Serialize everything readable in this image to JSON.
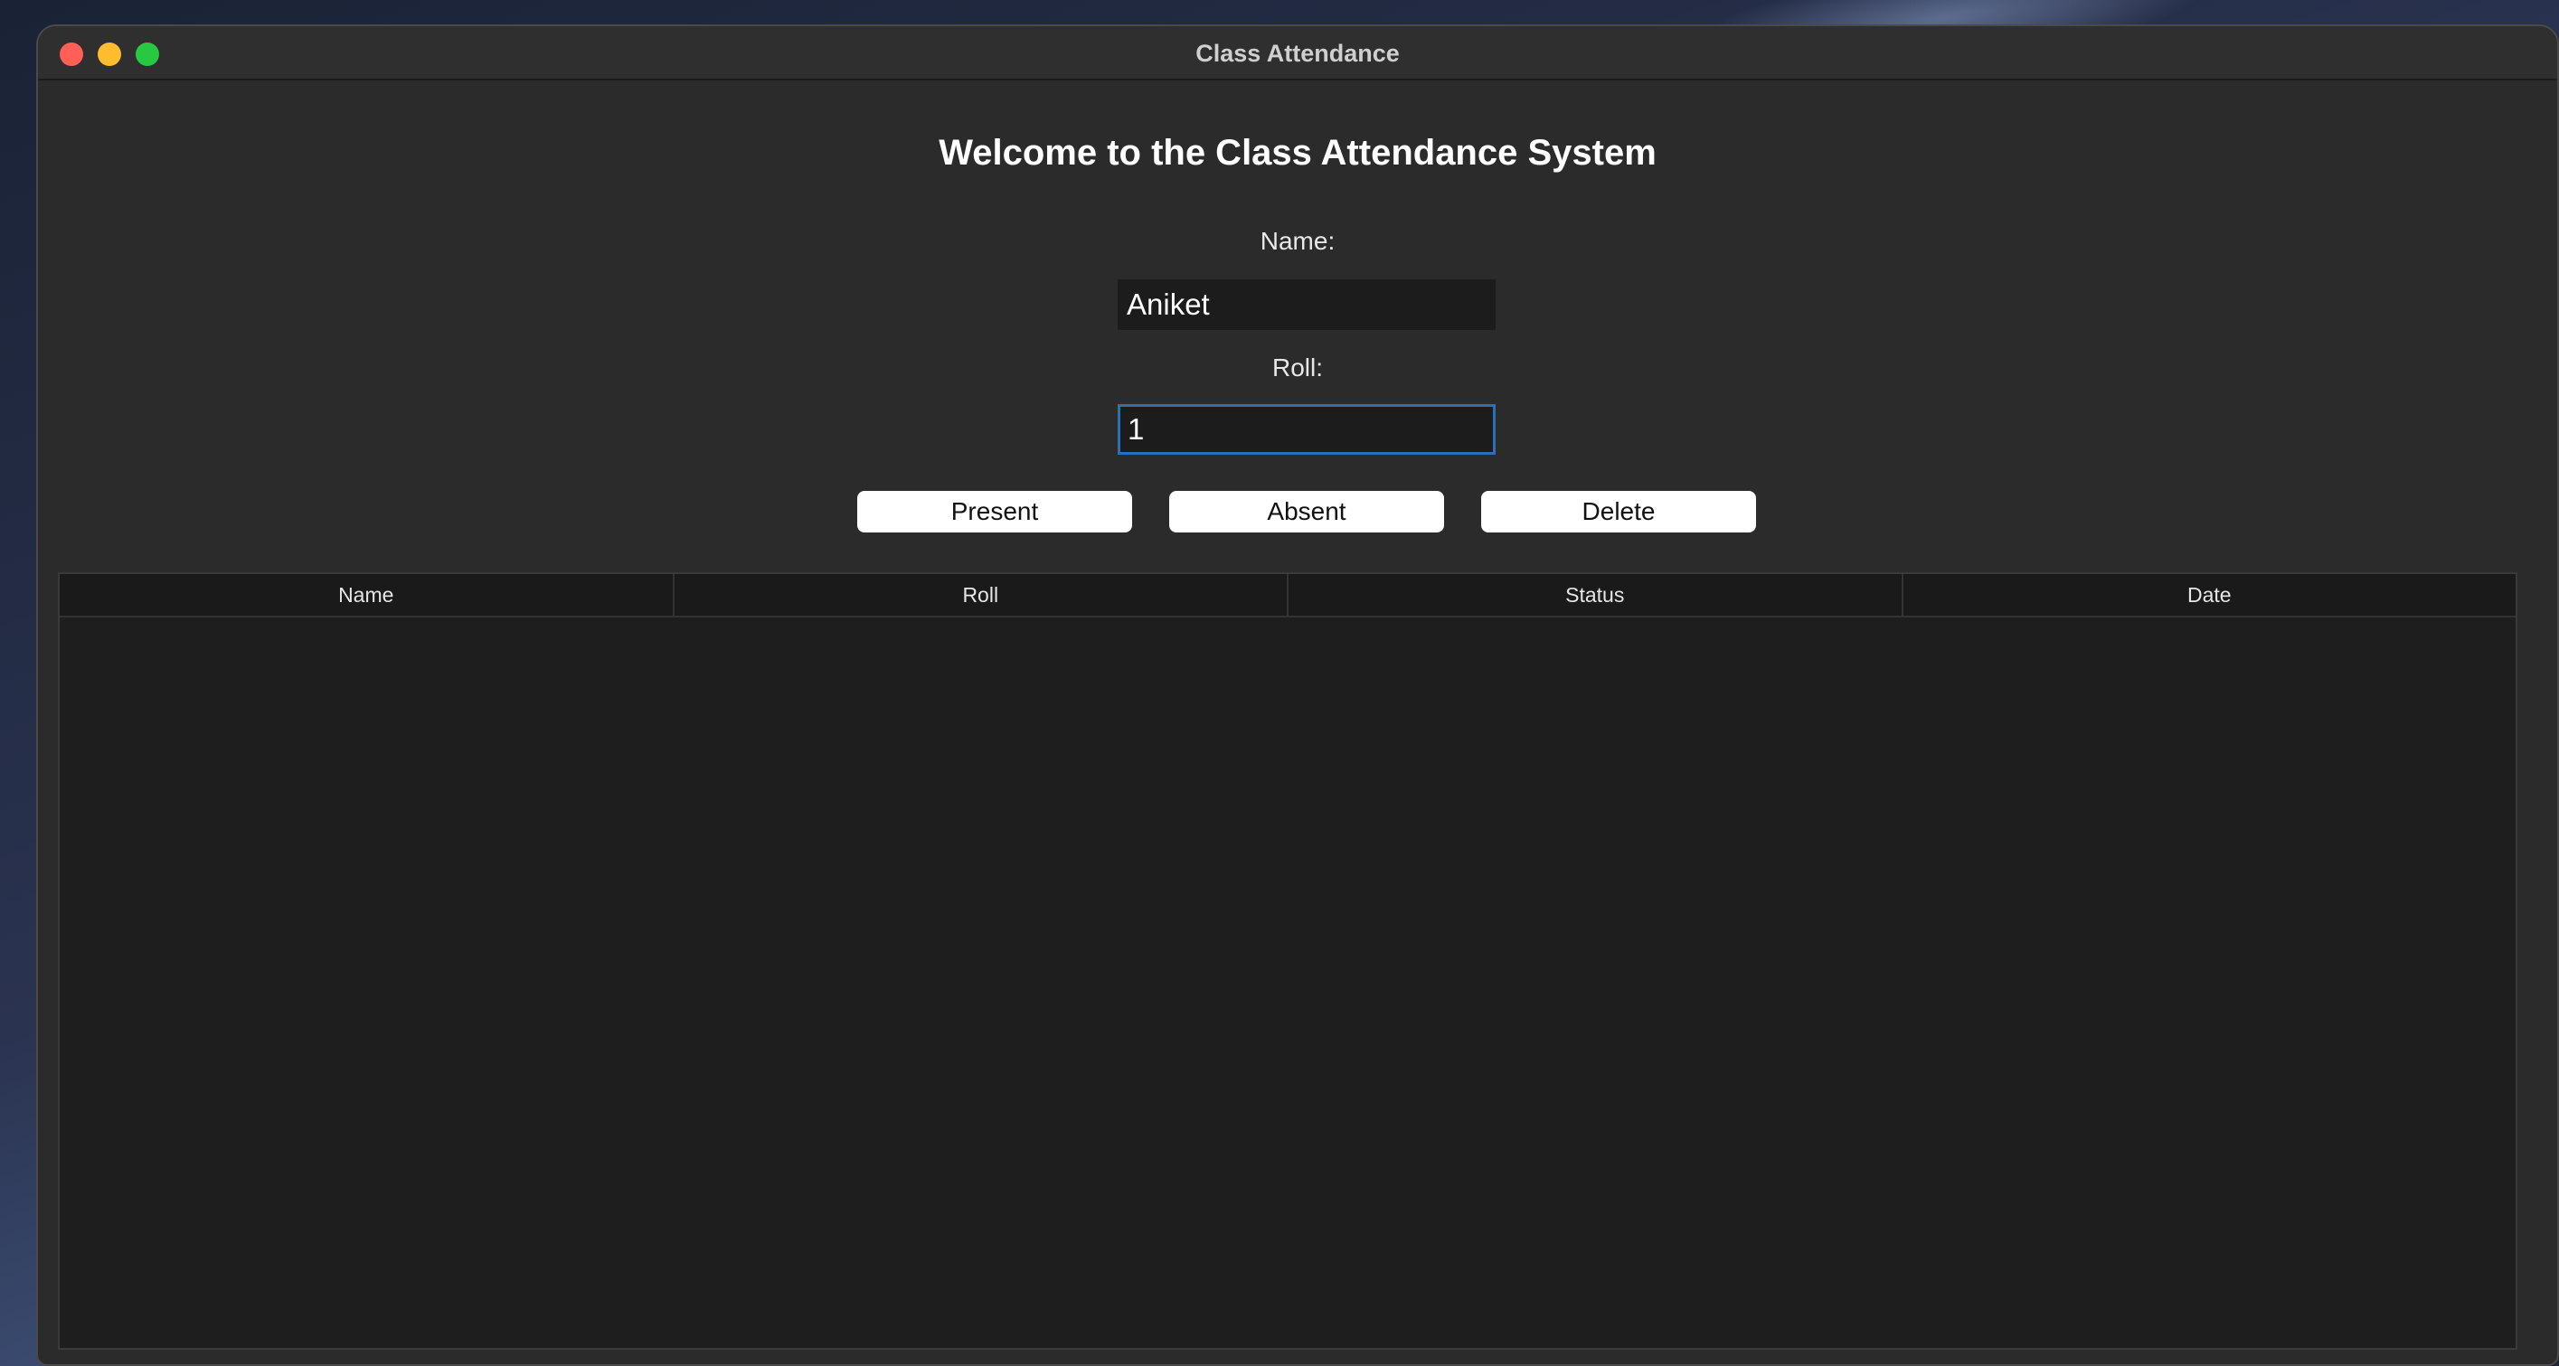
{
  "window": {
    "title": "Class Attendance"
  },
  "form": {
    "heading": "Welcome to the Class Attendance System",
    "name_label": "Name:",
    "name_value": "Aniket",
    "roll_label": "Roll:",
    "roll_value": "1"
  },
  "actions": {
    "present_label": "Present",
    "absent_label": "Absent",
    "delete_label": "Delete"
  },
  "table": {
    "columns": [
      "Name",
      "Roll",
      "Status",
      "Date"
    ],
    "rows": []
  },
  "colors": {
    "close": "#ff5f57",
    "minimize": "#febc2e",
    "maximize": "#28c840",
    "focus_ring": "#2d6fb5"
  },
  "icons": [
    "close-icon",
    "minimize-icon",
    "maximize-icon"
  ]
}
